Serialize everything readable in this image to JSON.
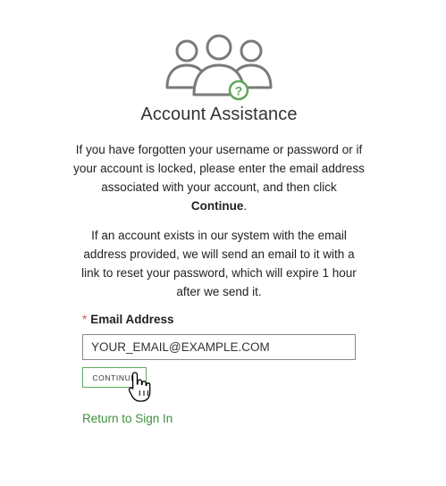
{
  "header": {
    "icon": "users-question-icon",
    "title": "Account Assistance"
  },
  "instructions": {
    "paragraph1_text": "If you have forgotten your username or password or if your account is locked, please enter the email address associated with your account, and then click ",
    "paragraph1_bold": "Continue",
    "paragraph1_end": ".",
    "paragraph2": "If an account exists in our system with the email address provided, we will send an email to it with a link to reset your password, which will expire 1 hour after we send it."
  },
  "form": {
    "required_marker": "*",
    "email_label": "Email Address",
    "email_placeholder": "YOUR_EMAIL@EXAMPLE.COM",
    "continue_label": "CONTINUE"
  },
  "footer": {
    "return_link": "Return to Sign In"
  },
  "colors": {
    "accent": "#5da85b",
    "link": "#3f8f3c",
    "icon_gray": "#7a7a7a",
    "required": "#d9534f"
  }
}
